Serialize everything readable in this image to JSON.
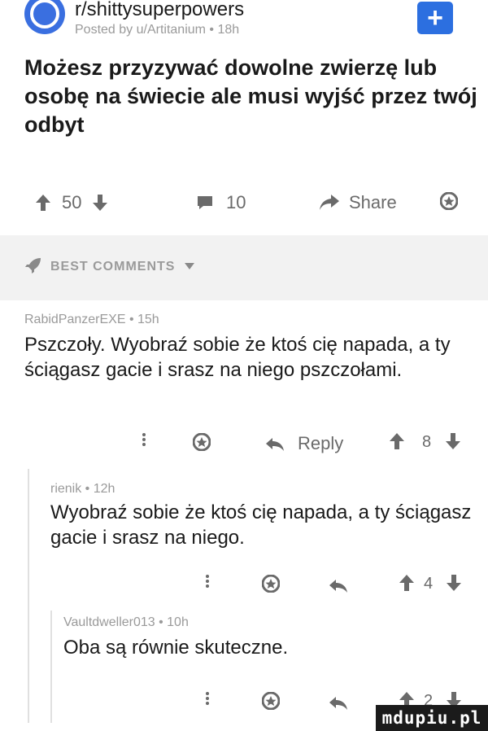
{
  "header": {
    "subreddit": "r/shittysuperpowers",
    "meta": "Posted by u/Artitanium • 18h",
    "join_icon": "+"
  },
  "post": {
    "title": "Możesz przyzywać dowolne zwierzę lub osobę na świecie ale musi wyjść przez twój odbyt"
  },
  "actions": {
    "votes": "50",
    "comments": "10",
    "share": "Share"
  },
  "best_comments": {
    "label": "BEST COMMENTS"
  },
  "comments": [
    {
      "meta": "RabidPanzerEXE • 15h",
      "body": "Pszczoły. Wyobraź sobie że ktoś cię napada, a ty ściągasz gacie i srasz na niego pszczołami.",
      "reply_label": "Reply",
      "votes": "8"
    },
    {
      "meta": "rienik • 12h",
      "body": "Wyobraź sobie że ktoś cię napada, a ty ściągasz gacie i srasz na niego.",
      "votes": "4"
    },
    {
      "meta": "Vaultdweller013 • 10h",
      "body": "Oba są równie skuteczne.",
      "votes": "2"
    }
  ],
  "watermark": "mdupiu.pl",
  "icons": {
    "upvote": "arrow-up-icon",
    "downvote": "arrow-down-icon",
    "comment": "comment-bubble-icon",
    "share": "share-arrow-icon",
    "award": "award-icon",
    "reply": "reply-arrow-icon",
    "more": "more-vertical-icon",
    "rocket": "rocket-icon"
  },
  "colors": {
    "accent": "#2c6fe0",
    "muted": "#9a9a9a",
    "text": "#1a1a1a",
    "best_bar_bg": "#f2f2f2"
  }
}
